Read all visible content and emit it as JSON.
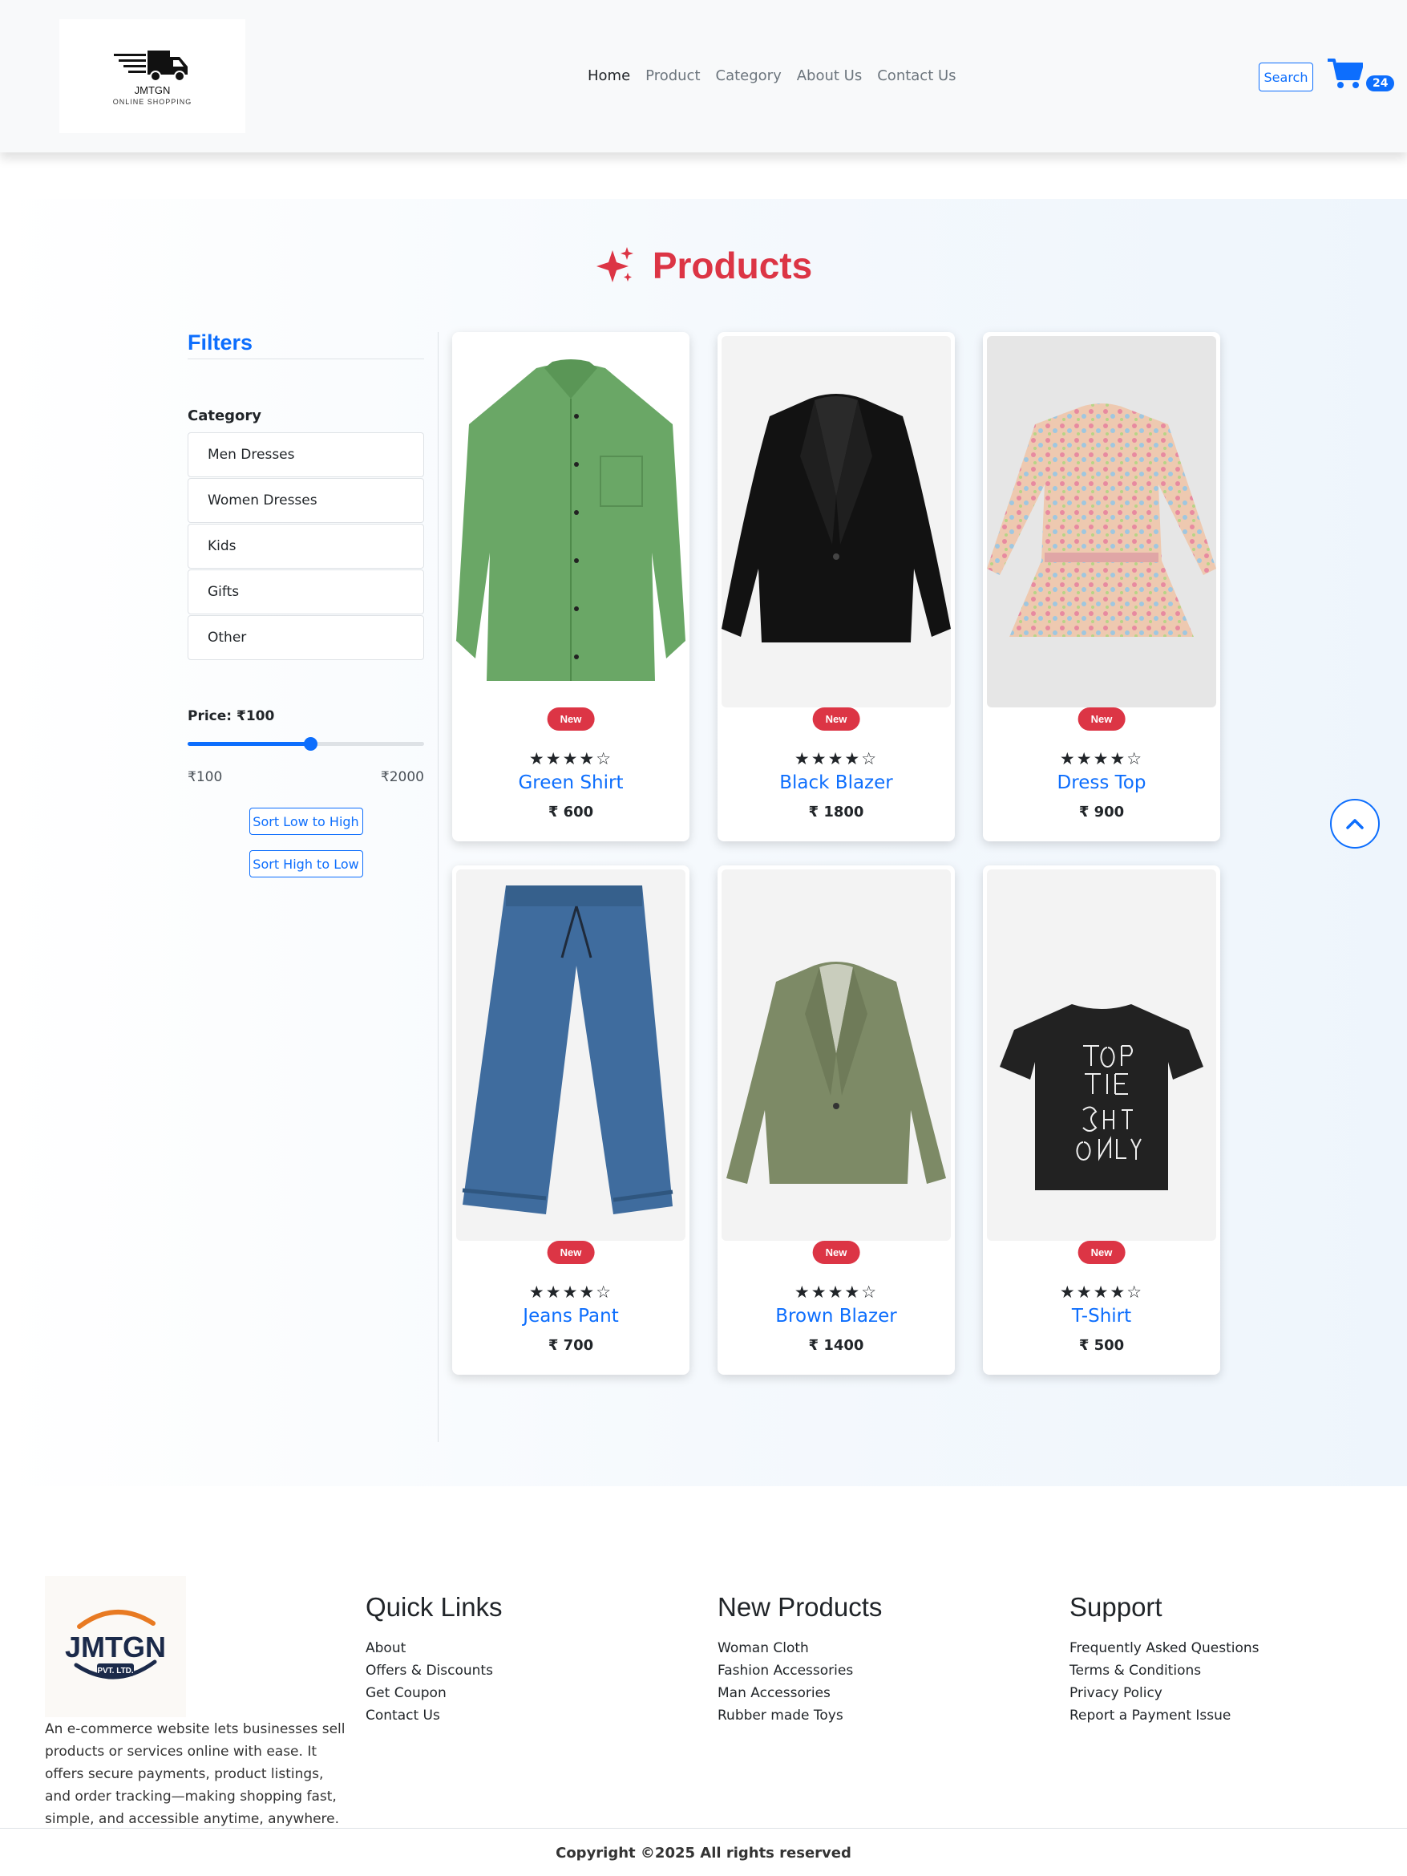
{
  "header": {
    "logo_text": "JMTGN",
    "logo_subtext": "ONLINE SHOPPING",
    "nav": [
      {
        "label": "Home",
        "active": true
      },
      {
        "label": "Product",
        "active": false
      },
      {
        "label": "Category",
        "active": false
      },
      {
        "label": "About Us",
        "active": false
      },
      {
        "label": "Contact Us",
        "active": false
      }
    ],
    "search_label": "Search",
    "cart_count": "24"
  },
  "products": {
    "title": "Products",
    "title_icon": "sparkles-icon",
    "items": [
      {
        "name": "Green Shirt",
        "price": "₹ 600",
        "badge": "New",
        "stars": "★★★★☆",
        "rating": 4
      },
      {
        "name": "Black Blazer",
        "price": "₹ 1800",
        "badge": "New",
        "stars": "★★★★☆",
        "rating": 4
      },
      {
        "name": "Dress Top",
        "price": "₹ 900",
        "badge": "New",
        "stars": "★★★★☆",
        "rating": 4
      },
      {
        "name": "Jeans Pant",
        "price": "₹ 700",
        "badge": "New",
        "stars": "★★★★☆",
        "rating": 4
      },
      {
        "name": "Brown Blazer",
        "price": "₹ 1400",
        "badge": "New",
        "stars": "★★★★☆",
        "rating": 4
      },
      {
        "name": "T-Shirt",
        "price": "₹ 500",
        "badge": "New",
        "stars": "★★★★☆",
        "rating": 4
      }
    ]
  },
  "filters": {
    "title": "Filters",
    "category_label": "Category",
    "categories": [
      "Men Dresses",
      "Women Dresses",
      "Kids",
      "Gifts",
      "Other"
    ],
    "price_label": "Price: ₹100",
    "price_min": "₹100",
    "price_max": "₹2000",
    "slider_fraction": 0.52,
    "sort_low_high": "Sort Low to High",
    "sort_high_low": "Sort High to Low"
  },
  "footer": {
    "logo_text": "JMTGN",
    "logo_subtext": "PVT. LTD.",
    "description": "An e-commerce website lets businesses sell products or services online with ease. It offers secure payments, product listings, and order tracking—making shopping fast, simple, and accessible anytime, anywhere.",
    "quick_links": {
      "title": "Quick Links",
      "links": [
        "About",
        "Offers & Discounts",
        "Get Coupon",
        "Contact Us"
      ]
    },
    "new_products": {
      "title": "New Products",
      "links": [
        "Woman Cloth",
        "Fashion Accessories",
        "Man Accessories",
        "Rubber made Toys"
      ]
    },
    "support": {
      "title": "Support",
      "links": [
        "Frequently Asked Questions",
        "Terms & Conditions",
        "Privacy Policy",
        "Report a Payment Issue"
      ]
    },
    "copyright": "Copyright ©2025 All rights reserved"
  },
  "colors": {
    "primary": "#0d6efd",
    "accent_red": "#dc3545",
    "header_bg": "#f8f9fa"
  }
}
